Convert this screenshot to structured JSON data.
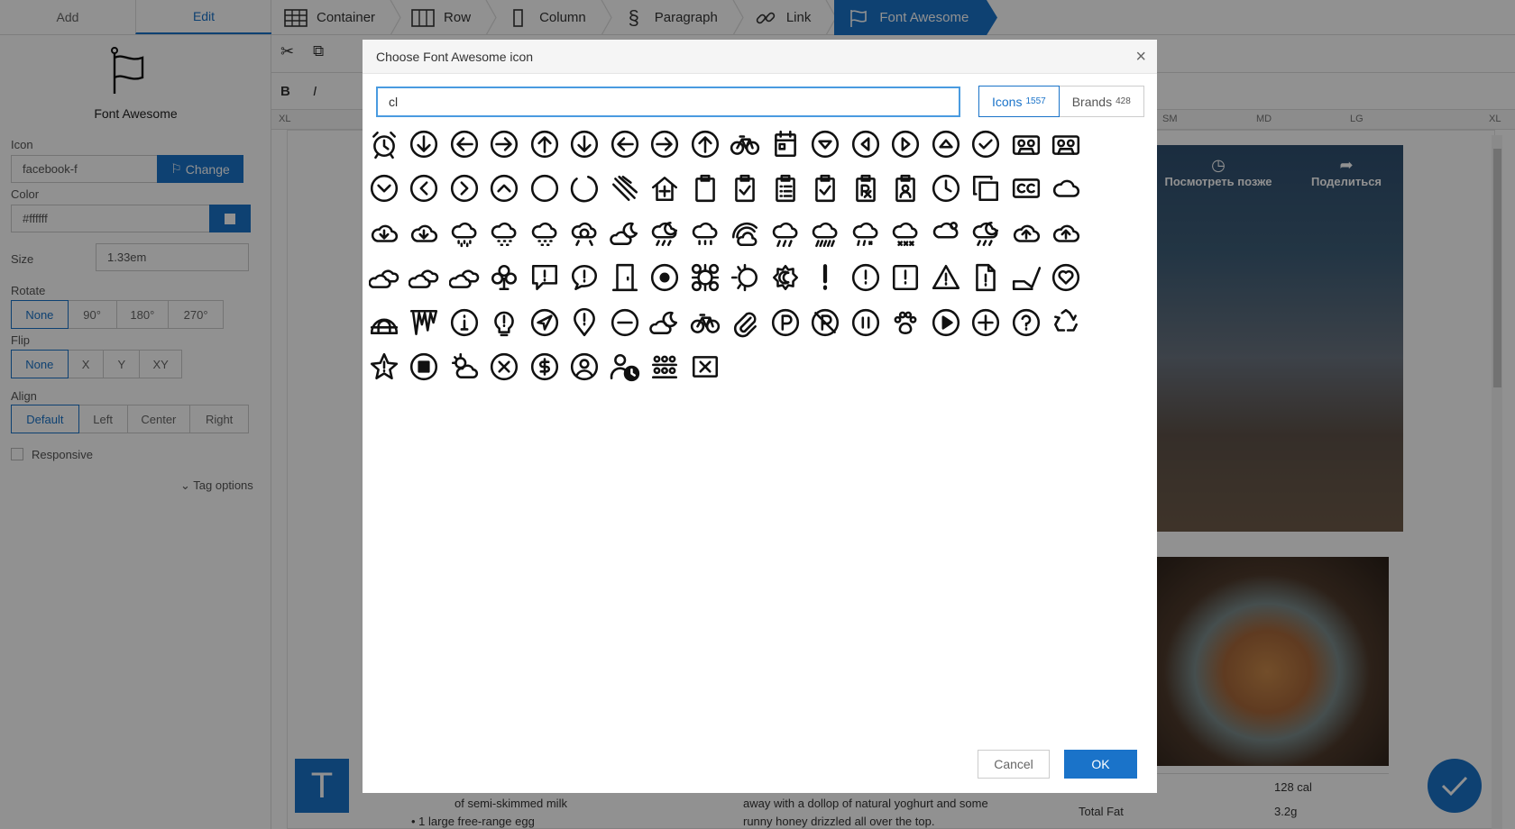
{
  "left_panel": {
    "tabs": [
      "Add",
      "Edit"
    ],
    "active_tab": "Edit",
    "title": "Font Awesome",
    "icon_label": "Icon",
    "icon_value": "facebook-f",
    "change_label": "Change",
    "color_label": "Color",
    "color_value": "#ffffff",
    "size_label": "Size",
    "size_value": "1.33em",
    "rotate_label": "Rotate",
    "rotate_options": [
      "None",
      "90°",
      "180°",
      "270°"
    ],
    "flip_label": "Flip",
    "flip_options": [
      "None",
      "X",
      "Y",
      "XY"
    ],
    "align_label": "Align",
    "align_options": [
      "Default",
      "Left",
      "Center",
      "Right"
    ],
    "responsive_label": "Responsive",
    "tag_options_label": "Tag options"
  },
  "breadcrumb": [
    "Container",
    "Row",
    "Column",
    "Paragraph",
    "Link",
    "Font Awesome"
  ],
  "ruler": {
    "left": "XL",
    "marks": [
      "SM",
      "MD",
      "LG",
      "XL"
    ]
  },
  "background_content": {
    "video_actions": [
      "Посмотреть позже",
      "Поделиться"
    ],
    "recipe_lines": [
      "of semi-skimmed milk",
      "1 large free-range egg"
    ],
    "description_lines": [
      "away with a dollop of natural yoghurt and some",
      "runny honey drizzled all over the top."
    ],
    "nutrition": [
      {
        "label": "",
        "value": "128 cal"
      },
      {
        "label": "Total Fat",
        "value": "3.2g"
      }
    ]
  },
  "modal": {
    "title": "Choose Font Awesome icon",
    "search_value": "cl",
    "tabs": [
      {
        "label": "Icons",
        "count": "1557"
      },
      {
        "label": "Brands",
        "count": "428"
      }
    ],
    "cancel_label": "Cancel",
    "ok_label": "OK",
    "icons": [
      "alarm-clock-icon",
      "arrow-alt-circle-down-icon",
      "arrow-alt-circle-left-icon",
      "arrow-alt-circle-right-icon",
      "arrow-alt-circle-up-icon",
      "arrow-circle-down-icon",
      "arrow-circle-left-icon",
      "arrow-circle-right-icon",
      "arrow-circle-up-icon",
      "bicycle-icon",
      "calendar-day-icon",
      "caret-circle-down-icon",
      "caret-circle-left-icon",
      "caret-circle-right-icon",
      "caret-circle-up-icon",
      "check-circle-icon",
      "cassette-tape-icon",
      "cassette-tape-alt-icon",
      "chevron-circle-down-icon",
      "chevron-circle-left-icon",
      "chevron-circle-right-icon",
      "chevron-circle-up-icon",
      "circle-icon",
      "circle-notch-icon",
      "claw-marks-icon",
      "clinic-medical-icon",
      "clipboard-icon",
      "clipboard-check-icon",
      "clipboard-list-icon",
      "clipboard-list-check-icon",
      "clipboard-prescription-icon",
      "clipboard-user-icon",
      "clock-icon",
      "clone-icon",
      "closed-captioning-icon",
      "cloud-icon",
      "cloud-download-icon",
      "cloud-download-alt-icon",
      "cloud-drizzle-icon",
      "cloud-hail-icon",
      "cloud-hail-mixed-icon",
      "cloud-meatball-icon",
      "cloud-moon-icon",
      "cloud-moon-rain-icon",
      "cloud-rain-icon",
      "cloud-rainbow-icon",
      "cloud-showers-icon",
      "cloud-showers-heavy-icon",
      "cloud-sleet-icon",
      "cloud-snow-icon",
      "cloud-sun-icon",
      "cloud-sun-rain-icon",
      "cloud-upload-icon",
      "cloud-upload-alt-icon",
      "clouds-icon",
      "clouds-moon-icon",
      "clouds-sun-icon",
      "club-icon",
      "comment-alt-exclamation-icon",
      "comment-exclamation-icon",
      "door-closed-icon",
      "dot-circle-icon",
      "drone-alt-icon",
      "eclipse-icon",
      "eclipse-alt-icon",
      "exclamation-icon",
      "exclamation-circle-icon",
      "exclamation-square-icon",
      "exclamation-triangle-icon",
      "file-exclamation-icon",
      "hand-holding-seedling-icon",
      "heart-circle-icon",
      "igloo-icon",
      "icicles-icon",
      "info-circle-icon",
      "lightbulb-exclamation-icon",
      "location-circle-icon",
      "map-marker-exclamation-icon",
      "minus-circle-icon",
      "moon-cloud-icon",
      "motorcycle-icon",
      "paperclip-icon",
      "parking-circle-icon",
      "parking-circle-slash-icon",
      "pause-circle-icon",
      "paw-claws-icon",
      "play-circle-icon",
      "plus-circle-icon",
      "question-circle-icon",
      "recycle-icon",
      "star-exclamation-icon",
      "stop-circle-icon",
      "sun-cloud-icon",
      "times-circle-icon",
      "usd-circle-icon",
      "user-circle-icon",
      "user-clock-icon",
      "users-class-icon",
      "window-close-icon"
    ]
  },
  "colors": {
    "accent": "#1a73c9",
    "overlay": "#000000"
  }
}
